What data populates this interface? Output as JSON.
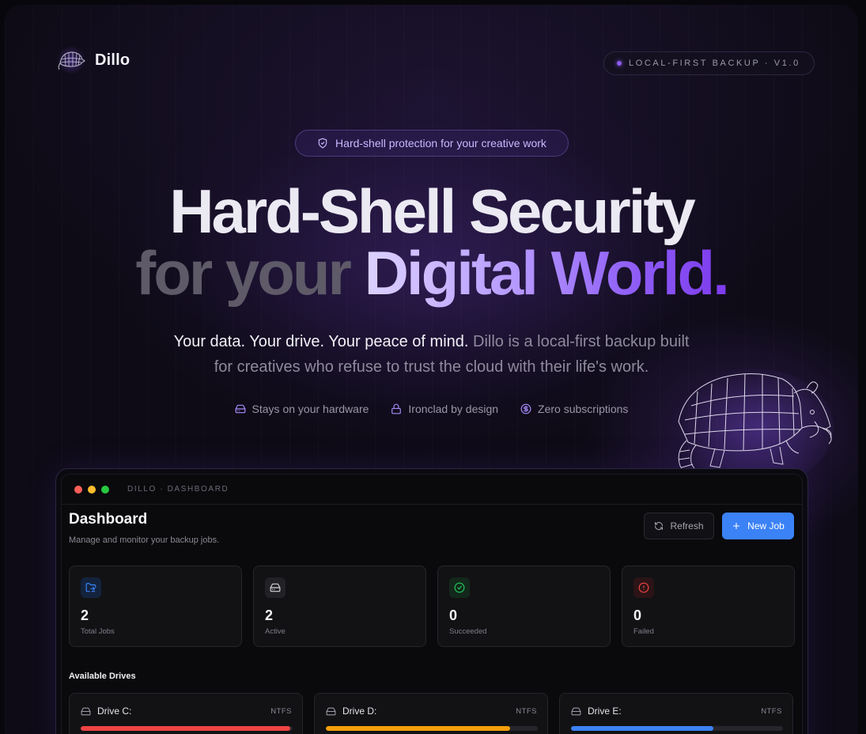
{
  "brand": {
    "name": "Dillo",
    "logo_icon": "armadillo-icon"
  },
  "version_badge": "LOCAL-FIRST BACKUP · V1.0",
  "hero": {
    "pill": "Hard-shell protection for your creative work",
    "headline_line1": "Hard-Shell Security",
    "headline_line2_muted": "for your",
    "headline_line2_accent": "Digital World.",
    "subtitle_bright": "Your data. Your drive. Your peace of mind.",
    "subtitle_rest": "Dillo is a local-first backup built",
    "subtitle_line2": "for creatives who refuse to trust the cloud with their life's work.",
    "features": [
      {
        "icon": "hard-drive-icon",
        "label": "Stays on your hardware"
      },
      {
        "icon": "lock-icon",
        "label": "Ironclad by design"
      },
      {
        "icon": "dollar-icon",
        "label": "Zero subscriptions"
      }
    ]
  },
  "window": {
    "title": "DILLO · DASHBOARD",
    "dashboard_title": "Dashboard",
    "dashboard_subtitle": "Manage and monitor your backup jobs.",
    "refresh_label": "Refresh",
    "new_job_label": "New Job",
    "stats": [
      {
        "icon": "folder-sync-icon",
        "value": "2",
        "label": "Total Jobs",
        "color": "#3b82f6"
      },
      {
        "icon": "hard-drive-icon",
        "value": "2",
        "label": "Active",
        "color": "#d4d4d8"
      },
      {
        "icon": "check-circle-icon",
        "value": "0",
        "label": "Succeeded",
        "color": "#22c55e"
      },
      {
        "icon": "alert-circle-icon",
        "value": "0",
        "label": "Failed",
        "color": "#ef4444"
      }
    ],
    "drives_title": "Available Drives",
    "drives": [
      {
        "name": "Drive C:",
        "fs": "NTFS",
        "usage": 0.99,
        "color": "#ef4444"
      },
      {
        "name": "Drive D:",
        "fs": "NTFS",
        "usage": 0.87,
        "color": "#f59e0b"
      },
      {
        "name": "Drive E:",
        "fs": "NTFS",
        "usage": 0.67,
        "color": "#3b82f6"
      }
    ]
  },
  "colors": {
    "accent": "#8b5cf6",
    "primary_button": "#3b82f6"
  }
}
